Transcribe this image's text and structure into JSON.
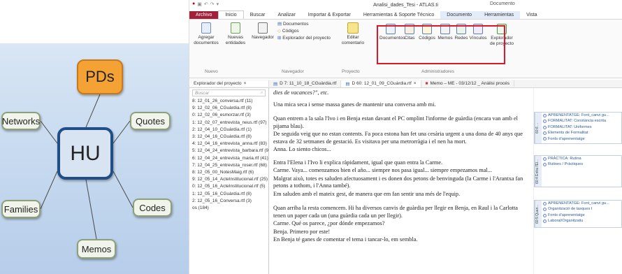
{
  "diagram": {
    "nodes": {
      "pds": "PDs",
      "hu": "HU",
      "networks": "Networks",
      "quotes": "Quotes",
      "families": "Families",
      "codes": "Codes",
      "memos": "Memos"
    }
  },
  "window": {
    "title": "Analisi_dades_Tesi - ATLAS.ti",
    "context_tab": "Documento"
  },
  "menu": {
    "tabs": [
      "Archivo",
      "Inicio",
      "Buscar",
      "Analizar",
      "Importar & Exportar",
      "Herramientas & Soporte Técnico",
      "Documento",
      "Herramientas",
      "Vista"
    ]
  },
  "ribbon": {
    "agregar": "Agregar documentos",
    "nuevas": "Nuevas entidades",
    "navegador": "Navegador",
    "documentos": "Documentos",
    "codigos": "Códigos",
    "explorador": "Explorador del proyecto",
    "editar": "Editar comentario",
    "adm_documentos": "Documentos",
    "adm_citas": "Citas",
    "adm_codigos": "Códigos",
    "adm_memos": "Memos",
    "adm_redes": "Redes",
    "adm_vinculos": "Vínculos",
    "adm_explorador": "Explorador de proyecto",
    "grp_nuevo": "Nuevo",
    "grp_navegador": "Navegador",
    "grp_proyecto": "Proyecto",
    "grp_admin": "Administradores"
  },
  "panel_tabs": {
    "explorer": "Explorador del proyecto",
    "doc1": "D 7: 11_10_18_CGuàrdia.rtf",
    "doc2": "D 60: 12_01_09_CGuàrdia.rtf",
    "memo": "Memo – ME - 03/12/12 _ Anàlisi procés"
  },
  "explorer": {
    "search_placeholder": "Buscar",
    "items": [
      "8: 12_01_26_conversa.rtf (11)",
      "9: 12_02_06_CGuàrdia.rtf (8)",
      "0: 12_02_06_esmorzar.rtf (3)",
      "1: 12_02_07_entrevista_neus.rtf (97)",
      "2: 12_04_10_CGuàrdia.rtf (1)",
      "3: 12_04_16_CGuàrdia.rtf (8)",
      "4: 12_04_16_entrevista_anna.rtf (83)",
      "5: 12_04_24_entrevista_barbara.rtf (9",
      "6: 12_04_24_entrevista_maria.rtf (41)",
      "7: 12_04_25_entrevista_roser.rtf (68)",
      "8: 12_05_00_NotesMaig.rtf (6)",
      "9: 12_05_14_ActeInstitucional.rtf (25)",
      "0: 12_05_16_ActeInstitucional.rtf (5)",
      "1: 12_05_16_CGuàrdia.rtf (8)",
      "2: 12_05_16_Conversa.rtf (3)",
      "os (184)"
    ]
  },
  "document": {
    "paragraphs": [
      "dies de vacances?\", etc.",
      "Una mica seca i sense massa ganes de mantenir una conversa amb mi.",
      "Quan entrem a la sala l'Ivo i en Benja estan davant el PC omplint l'informe de guàrdia (encara van amb el pijama blau).",
      "De seguida veig que no estan contents. Fa poca estona han fet una cesària urgent a una dona de 40 anys que estava de 32 setmanes de gestació. Es visitava per una metrorràgia i el nen ha mort.",
      "Anna. Lo siento chicos...",
      "Entra l'Elena i l'Ivo li explica ràpidament, igual que quan entra la Carme.",
      "Carme. Vaya... comenzamos bien el año... siempre nos pasa igual... siempre empezamos mal...",
      "Malgrat això, totes es saluden afectuosament i es donen dos petons de benvinguda (la Carme i l'Arantxa fan petons a tothom, i l'Anna també).",
      "Em saluden amb el mateix gest, de manera que em fan sentir una més de l'equip.",
      "Quan arriba la resta comencem. Hi ha diversos canvis de guàrdia per llegir en Benja, en Raul i la Carlotta tenen un paper cada un (una guàrdia cada un per llegir).",
      "Carme. Qué os parece, ¿por dónde empezamos?",
      "Benja. Primero por este!",
      "En Benja té ganes de comentar el tema i tancar-lo, em sembla."
    ]
  },
  "margin": {
    "block1_label": "60:6 ...",
    "block1": [
      "APRENENTATGE: Font_canvi gu...",
      "FORMALITAT: Constància escrita",
      "FORMALITAT: Uniformes",
      "Elements de Formalitat",
      "Fonts d'aprenentatge"
    ],
    "block2_label": "60:4 Entra l'El...",
    "block2": [
      "PRÀCTICA: Rutina",
      "Rutines / Pràctiques"
    ],
    "block3_label": "60:5 Quan...",
    "block3": [
      "APRENENTATGE: Font_canvi gu...",
      "Organització de tasques I",
      "Fonts d'aprenentatge",
      "Laboral/Organitzatiu"
    ]
  }
}
